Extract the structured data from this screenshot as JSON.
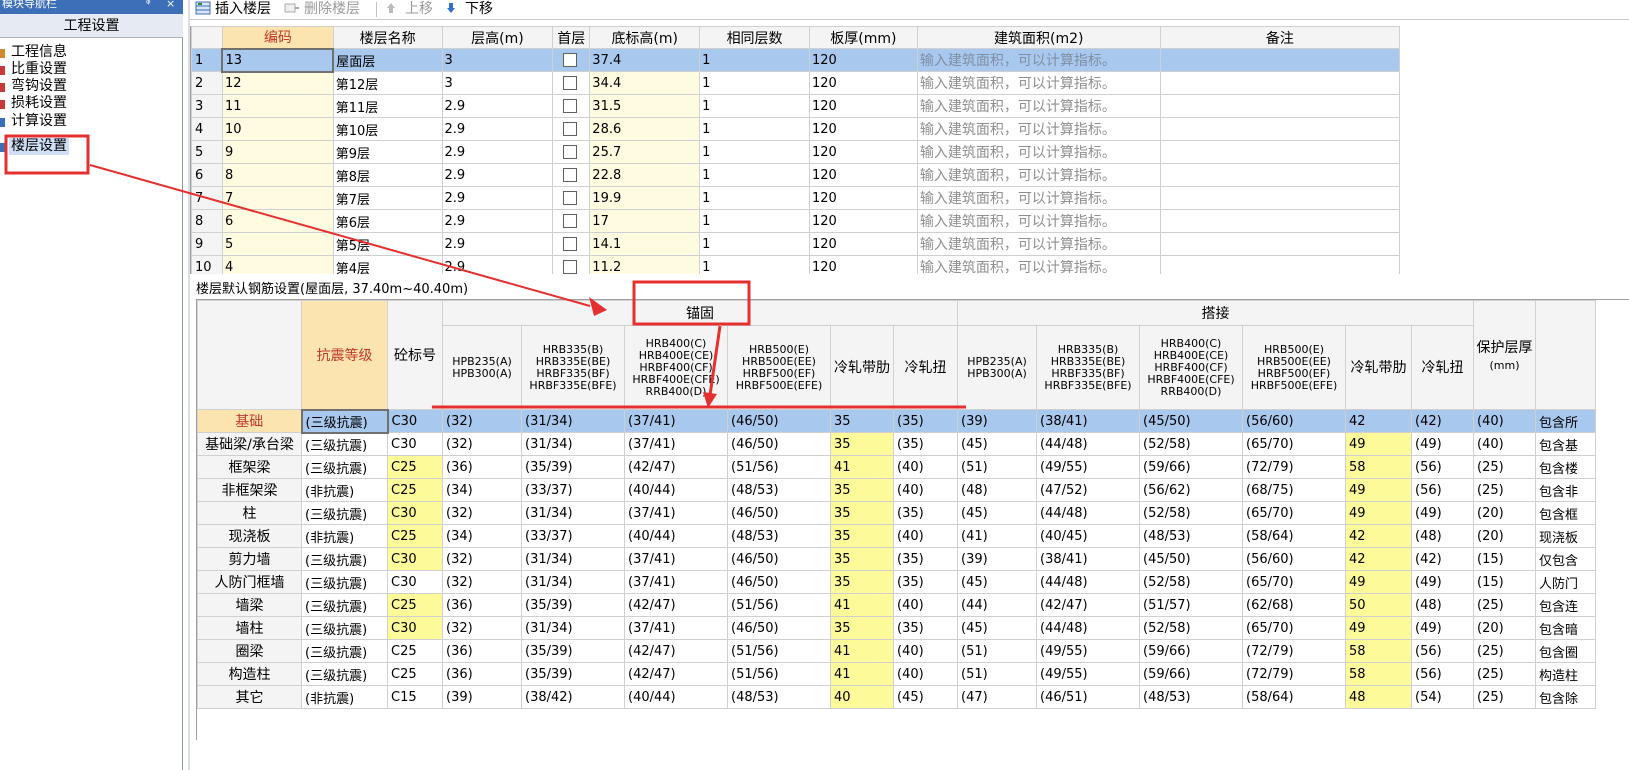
{
  "nav": {
    "titlebar": "模块导航栏",
    "pin": "ᵠ ×",
    "close": "×",
    "header": "工程设置",
    "items": [
      {
        "label": "工程信息",
        "icon": "project-info-icon"
      },
      {
        "label": "比重设置",
        "icon": "density-icon"
      },
      {
        "label": "弯钩设置",
        "icon": "hook-icon"
      },
      {
        "label": "损耗设置",
        "icon": "loss-icon"
      },
      {
        "label": "计算设置",
        "icon": "calc-icon"
      },
      {
        "label": "楼层设置",
        "icon": "floor-icon"
      }
    ]
  },
  "toolbar": {
    "insert": "插入楼层",
    "delete": "删除楼层",
    "up": "上移",
    "down": "下移"
  },
  "floors": {
    "headers": [
      "编码",
      "楼层名称",
      "层高(m)",
      "首层",
      "底标高(m)",
      "相同层数",
      "板厚(mm)",
      "建筑面积(m2)",
      "备注"
    ],
    "placeholder": "输入建筑面积，可以计算指标。",
    "rows": [
      {
        "n": "1",
        "code": "13",
        "name": "屋面层",
        "height": "3",
        "bottom": "37.4",
        "same": "1",
        "slab": "120"
      },
      {
        "n": "2",
        "code": "12",
        "name": "第12层",
        "height": "3",
        "bottom": "34.4",
        "same": "1",
        "slab": "120"
      },
      {
        "n": "3",
        "code": "11",
        "name": "第11层",
        "height": "2.9",
        "bottom": "31.5",
        "same": "1",
        "slab": "120"
      },
      {
        "n": "4",
        "code": "10",
        "name": "第10层",
        "height": "2.9",
        "bottom": "28.6",
        "same": "1",
        "slab": "120"
      },
      {
        "n": "5",
        "code": "9",
        "name": "第9层",
        "height": "2.9",
        "bottom": "25.7",
        "same": "1",
        "slab": "120"
      },
      {
        "n": "6",
        "code": "8",
        "name": "第8层",
        "height": "2.9",
        "bottom": "22.8",
        "same": "1",
        "slab": "120"
      },
      {
        "n": "7",
        "code": "7",
        "name": "第7层",
        "height": "2.9",
        "bottom": "19.9",
        "same": "1",
        "slab": "120"
      },
      {
        "n": "8",
        "code": "6",
        "name": "第6层",
        "height": "2.9",
        "bottom": "17",
        "same": "1",
        "slab": "120"
      },
      {
        "n": "9",
        "code": "5",
        "name": "第5层",
        "height": "2.9",
        "bottom": "14.1",
        "same": "1",
        "slab": "120"
      },
      {
        "n": "10",
        "code": "4",
        "name": "第4层",
        "height": "2.9",
        "bottom": "11.2",
        "same": "1",
        "slab": "120"
      }
    ]
  },
  "rebar": {
    "title": "楼层默认钢筋设置(屋面层, 37.40m~40.40m)",
    "group_anchor": "锚固",
    "group_lap": "搭接",
    "col_seismic": "抗震等级",
    "col_concrete": "砼标号",
    "col_cover": "保护层厚",
    "col_cover_unit": "(mm)",
    "sub_headers": [
      "HPB235(A) HPB300(A)",
      "HRB335(B) HRB335E(BE) HRBF335(BF) HRBF335E(BFE)",
      "HRB400(C) HRB400E(CE) HRBF400(CF) HRBF400E(CFE) RRB400(D)",
      "HRB500(E) HRB500E(EE) HRBF500(EF) HRBF500E(EFE)",
      "冷轧带肋",
      "冷轧扭",
      "HPB235(A) HPB300(A)",
      "HRB335(B) HRB335E(BE) HRBF335(BF) HRBF335E(BFE)",
      "HRB400(C) HRB400E(CE) HRBF400(CF) HRBF400E(CFE) RRB400(D)",
      "HRB500(E) HRB500E(EE) HRBF500(EF) HRBF500E(EFE)",
      "冷轧带肋",
      "冷轧扭"
    ],
    "rows": [
      {
        "name": "基础",
        "seismic": "(三级抗震)",
        "concrete": "C30",
        "a": [
          "(32)",
          "(31/34)",
          "(37/41)",
          "(46/50)",
          "35",
          "(35)"
        ],
        "l": [
          "(39)",
          "(38/41)",
          "(45/50)",
          "(56/60)",
          "42",
          "(42)"
        ],
        "cover": "(40)",
        "note": "包含所"
      },
      {
        "name": "基础梁/承台梁",
        "seismic": "(三级抗震)",
        "concrete": "C30",
        "a": [
          "(32)",
          "(31/34)",
          "(37/41)",
          "(46/50)",
          "35",
          "(35)"
        ],
        "l": [
          "(45)",
          "(44/48)",
          "(52/58)",
          "(65/70)",
          "49",
          "(49)"
        ],
        "cover": "(40)",
        "note": "包含基"
      },
      {
        "name": "框架梁",
        "seismic": "(三级抗震)",
        "concrete": "C25",
        "a": [
          "(36)",
          "(35/39)",
          "(42/47)",
          "(51/56)",
          "41",
          "(40)"
        ],
        "l": [
          "(51)",
          "(49/55)",
          "(59/66)",
          "(72/79)",
          "58",
          "(56)"
        ],
        "cover": "(25)",
        "note": "包含楼"
      },
      {
        "name": "非框架梁",
        "seismic": "(非抗震)",
        "concrete": "C25",
        "a": [
          "(34)",
          "(33/37)",
          "(40/44)",
          "(48/53)",
          "35",
          "(40)"
        ],
        "l": [
          "(48)",
          "(47/52)",
          "(56/62)",
          "(68/75)",
          "49",
          "(56)"
        ],
        "cover": "(25)",
        "note": "包含非"
      },
      {
        "name": "柱",
        "seismic": "(三级抗震)",
        "concrete": "C30",
        "a": [
          "(32)",
          "(31/34)",
          "(37/41)",
          "(46/50)",
          "35",
          "(35)"
        ],
        "l": [
          "(45)",
          "(44/48)",
          "(52/58)",
          "(65/70)",
          "49",
          "(49)"
        ],
        "cover": "(20)",
        "note": "包含框"
      },
      {
        "name": "现浇板",
        "seismic": "(非抗震)",
        "concrete": "C25",
        "a": [
          "(34)",
          "(33/37)",
          "(40/44)",
          "(48/53)",
          "35",
          "(40)"
        ],
        "l": [
          "(41)",
          "(40/45)",
          "(48/53)",
          "(58/64)",
          "42",
          "(48)"
        ],
        "cover": "(20)",
        "note": "现浇板"
      },
      {
        "name": "剪力墙",
        "seismic": "(三级抗震)",
        "concrete": "C30",
        "a": [
          "(32)",
          "(31/34)",
          "(37/41)",
          "(46/50)",
          "35",
          "(35)"
        ],
        "l": [
          "(39)",
          "(38/41)",
          "(45/50)",
          "(56/60)",
          "42",
          "(42)"
        ],
        "cover": "(15)",
        "note": "仅包含"
      },
      {
        "name": "人防门框墙",
        "seismic": "(三级抗震)",
        "concrete": "C30",
        "a": [
          "(32)",
          "(31/34)",
          "(37/41)",
          "(46/50)",
          "35",
          "(35)"
        ],
        "l": [
          "(45)",
          "(44/48)",
          "(52/58)",
          "(65/70)",
          "49",
          "(49)"
        ],
        "cover": "(15)",
        "note": "人防门"
      },
      {
        "name": "墙梁",
        "seismic": "(三级抗震)",
        "concrete": "C25",
        "a": [
          "(36)",
          "(35/39)",
          "(42/47)",
          "(51/56)",
          "41",
          "(40)"
        ],
        "l": [
          "(44)",
          "(42/47)",
          "(51/57)",
          "(62/68)",
          "50",
          "(48)"
        ],
        "cover": "(25)",
        "note": "包含连"
      },
      {
        "name": "墙柱",
        "seismic": "(三级抗震)",
        "concrete": "C30",
        "a": [
          "(32)",
          "(31/34)",
          "(37/41)",
          "(46/50)",
          "35",
          "(35)"
        ],
        "l": [
          "(45)",
          "(44/48)",
          "(52/58)",
          "(65/70)",
          "49",
          "(49)"
        ],
        "cover": "(20)",
        "note": "包含暗"
      },
      {
        "name": "圈梁",
        "seismic": "(三级抗震)",
        "concrete": "C25",
        "a": [
          "(36)",
          "(35/39)",
          "(42/47)",
          "(51/56)",
          "41",
          "(40)"
        ],
        "l": [
          "(51)",
          "(49/55)",
          "(59/66)",
          "(72/79)",
          "58",
          "(56)"
        ],
        "cover": "(25)",
        "note": "包含圈"
      },
      {
        "name": "构造柱",
        "seismic": "(三级抗震)",
        "concrete": "C25",
        "a": [
          "(36)",
          "(35/39)",
          "(42/47)",
          "(51/56)",
          "41",
          "(40)"
        ],
        "l": [
          "(51)",
          "(49/55)",
          "(59/66)",
          "(72/79)",
          "58",
          "(56)"
        ],
        "cover": "(25)",
        "note": "构造柱"
      },
      {
        "name": "其它",
        "seismic": "(非抗震)",
        "concrete": "C15",
        "a": [
          "(39)",
          "(38/42)",
          "(40/44)",
          "(48/53)",
          "40",
          "(45)"
        ],
        "l": [
          "(47)",
          "(46/51)",
          "(48/53)",
          "(58/64)",
          "48",
          "(54)"
        ],
        "cover": "(25)",
        "note": "包含除"
      }
    ]
  },
  "colors": {
    "selected_row": "#a9c8ee",
    "header_highlight": "#fbe4b0",
    "yellow_cell": "#fdfa9a",
    "annotation_red": "#e53030"
  }
}
